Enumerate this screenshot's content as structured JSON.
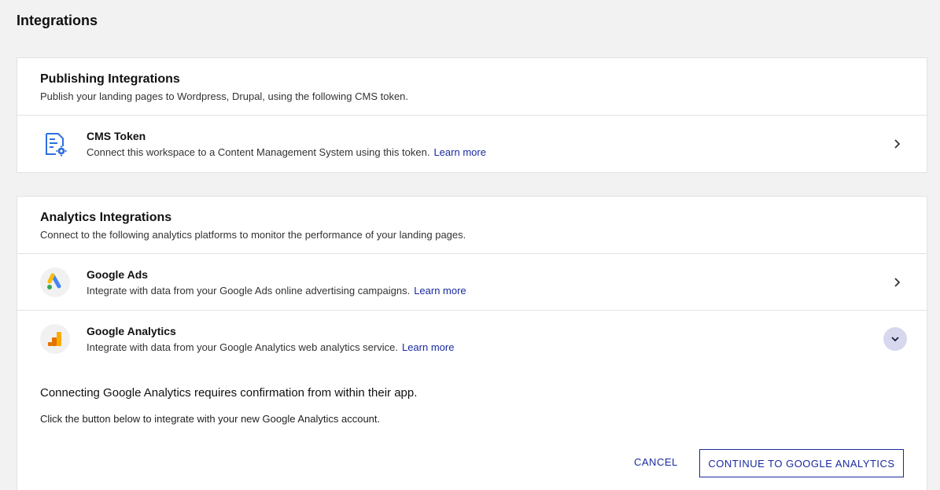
{
  "page": {
    "title": "Integrations"
  },
  "publishing": {
    "heading": "Publishing Integrations",
    "subheading": "Publish your landing pages to Wordpress, Drupal, using the following CMS token.",
    "cms": {
      "title": "CMS Token",
      "description": "Connect this workspace to a Content Management System using this token.",
      "learn_more": "Learn more",
      "icon": "document-gear-icon"
    }
  },
  "analytics": {
    "heading": "Analytics Integrations",
    "subheading": "Connect to the following analytics platforms to monitor the performance of your landing pages.",
    "google_ads": {
      "title": "Google Ads",
      "description": "Integrate with data from your Google Ads online advertising campaigns.",
      "learn_more": "Learn more",
      "icon": "google-ads-icon"
    },
    "google_analytics": {
      "title": "Google Analytics",
      "description": "Integrate with data from your Google Analytics web analytics service.",
      "learn_more": "Learn more",
      "icon": "google-analytics-icon",
      "expanded": true,
      "confirm_message": "Connecting Google Analytics requires confirmation from within their app.",
      "instruction": "Click the button below to integrate with your new Google Analytics account.",
      "cancel_label": "CANCEL",
      "continue_label": "CONTINUE TO GOOGLE ANALYTICS"
    }
  },
  "colors": {
    "accent": "#1a2a9e",
    "expand_button_bg": "#d7d8ee",
    "page_bg": "#f2f2f2"
  }
}
